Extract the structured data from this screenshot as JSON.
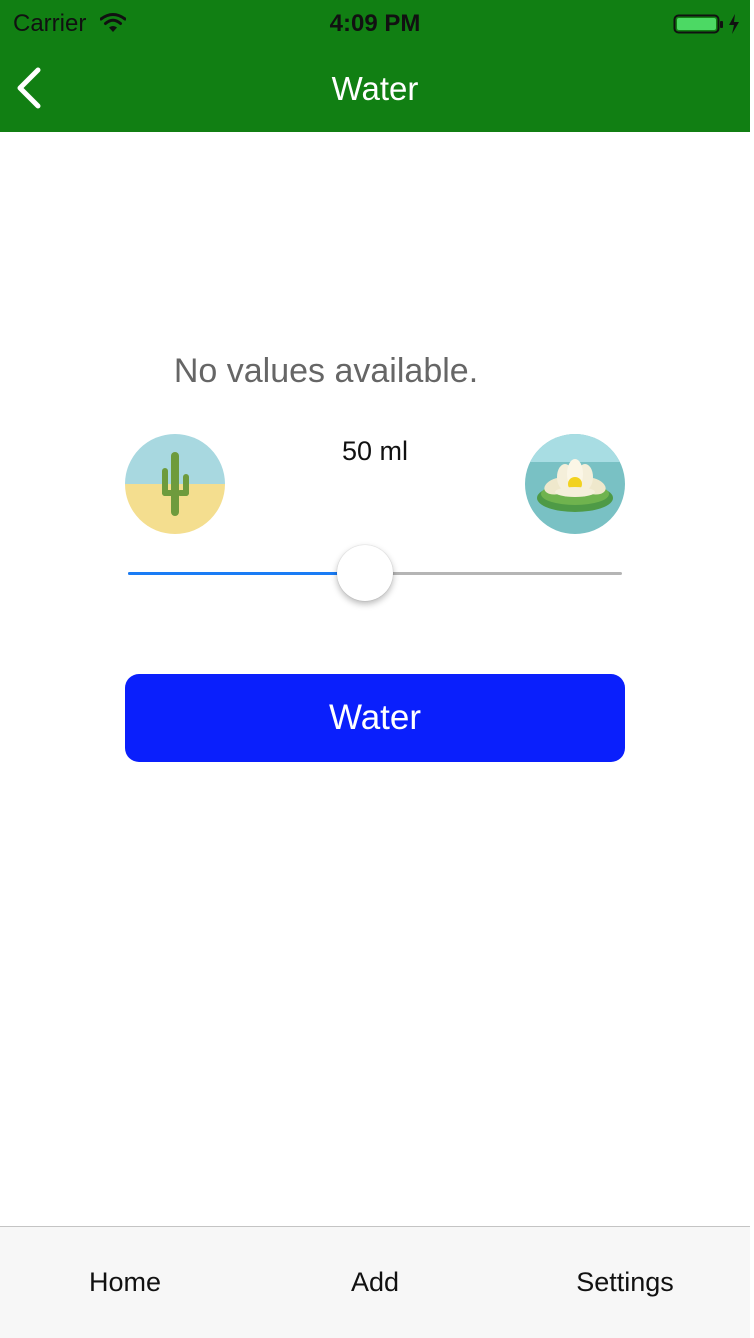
{
  "status_bar": {
    "carrier": "Carrier",
    "time": "4:09 PM",
    "icons": [
      "wifi-icon",
      "battery-icon",
      "charging-bolt-icon"
    ]
  },
  "nav_bar": {
    "back_icon": "chevron-left-icon",
    "title": "Water",
    "background_color": "#117f13"
  },
  "main": {
    "empty_message": "No values available.",
    "amount_label": "50 ml",
    "min_icon": "cactus-icon",
    "max_icon": "lotus-icon",
    "slider": {
      "value_fraction": 0.5,
      "fill_color": "#1a7cf5",
      "track_color": "#b5b5b5"
    },
    "water_button": {
      "label": "Water",
      "color": "#0a1ffc"
    }
  },
  "tab_bar": {
    "items": [
      {
        "label": "Home"
      },
      {
        "label": "Add"
      },
      {
        "label": "Settings"
      }
    ]
  }
}
